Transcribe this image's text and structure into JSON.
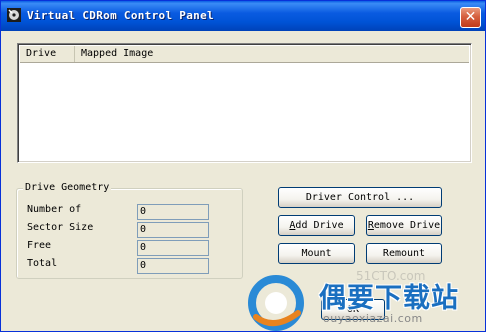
{
  "window": {
    "title": "Virtual CDRom Control Panel",
    "close_glyph": "✕"
  },
  "list": {
    "columns": [
      "Drive",
      "Mapped Image"
    ],
    "rows": []
  },
  "geometry": {
    "legend": "Drive Geometry",
    "fields": [
      {
        "label": "Number of",
        "value": "0"
      },
      {
        "label": "Sector Size",
        "value": "0"
      },
      {
        "label": "Free",
        "value": "0"
      },
      {
        "label": "Total",
        "value": "0"
      }
    ]
  },
  "buttons": {
    "driver_control": "Driver Control ...",
    "add_drive_mnemonic": "A",
    "add_drive_rest": "dd Drive",
    "remove_drive_mnemonic": "R",
    "remove_drive_rest": "emove Drive",
    "mount": "Mount",
    "remount": "Remount",
    "ok": "OK"
  },
  "watermark": {
    "brand": "偶要下载站",
    "url": "ouyaoxiazai.com",
    "faint": "51CTO.com"
  },
  "colors": {
    "titlebar": "#0054e3",
    "window_bg": "#ece9d8",
    "close_button": "#d6603f",
    "watermark": "#1a6fc0"
  },
  "icons": {
    "app": "cd-drive-icon",
    "close": "close-icon",
    "watermark": "brand-logo-icon"
  }
}
